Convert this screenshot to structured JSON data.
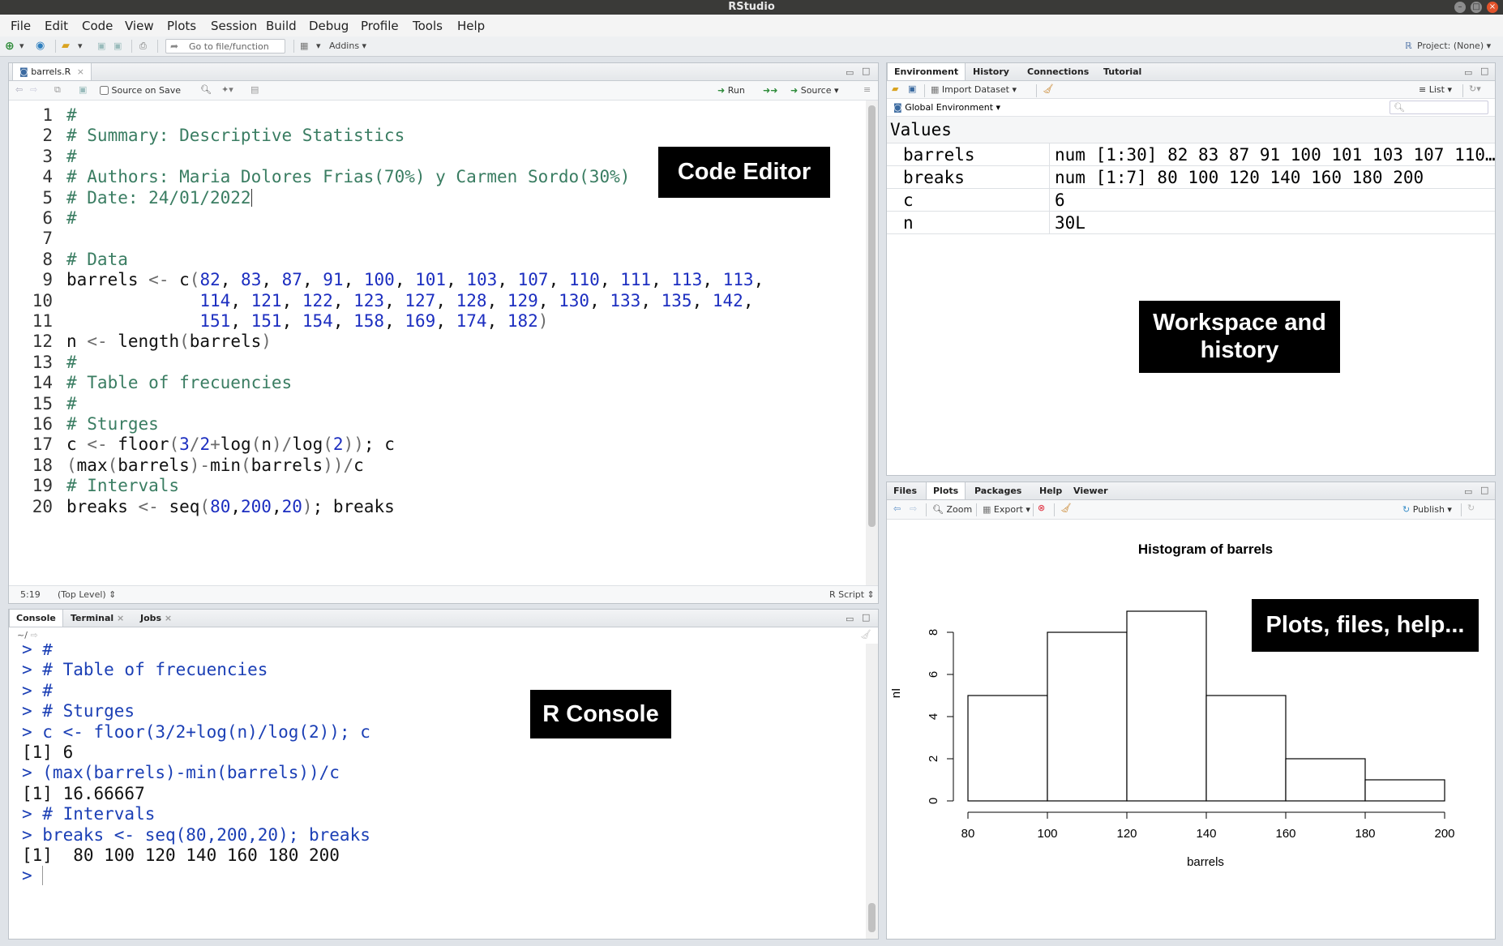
{
  "window": {
    "title": "RStudio"
  },
  "menu": [
    "File",
    "Edit",
    "Code",
    "View",
    "Plots",
    "Session",
    "Build",
    "Debug",
    "Profile",
    "Tools",
    "Help"
  ],
  "toolbar": {
    "goto_placeholder": "Go to file/function",
    "addins": "Addins",
    "project": "Project: (None)"
  },
  "editor": {
    "tab": "barrels.R",
    "source_on_save": "Source on Save",
    "run": "Run",
    "source": "Source",
    "status_pos": "5:19",
    "status_level": "(Top Level)",
    "status_type": "R Script",
    "lines": [
      {
        "n": "1",
        "text": "#"
      },
      {
        "n": "2",
        "text": "# Summary: Descriptive Statistics"
      },
      {
        "n": "3",
        "text": "#"
      },
      {
        "n": "4",
        "text": "# Authors: Maria Dolores Frias(70%) y Carmen Sordo(30%)"
      },
      {
        "n": "5",
        "text": "# Date: 24/01/2022"
      },
      {
        "n": "6",
        "text": "#"
      },
      {
        "n": "7",
        "text": ""
      },
      {
        "n": "8",
        "text": "# Data"
      },
      {
        "n": "9",
        "text": "barrels <- c(82, 83, 87, 91, 100, 101, 103, 107, 110, 111, 113, 113,"
      },
      {
        "n": "10",
        "text": "             114, 121, 122, 123, 127, 128, 129, 130, 133, 135, 142,"
      },
      {
        "n": "11",
        "text": "             151, 151, 154, 158, 169, 174, 182)"
      },
      {
        "n": "12",
        "text": "n <- length(barrels)"
      },
      {
        "n": "13",
        "text": "#"
      },
      {
        "n": "14",
        "text": "# Table of frecuencies"
      },
      {
        "n": "15",
        "text": "#"
      },
      {
        "n": "16",
        "text": "# Sturges"
      },
      {
        "n": "17",
        "text": "c <- floor(3/2+log(n)/log(2)); c"
      },
      {
        "n": "18",
        "text": "(max(barrels)-min(barrels))/c"
      },
      {
        "n": "19",
        "text": "# Intervals"
      },
      {
        "n": "20",
        "text": "breaks <- seq(80,200,20); breaks"
      }
    ]
  },
  "console": {
    "tabs": [
      "Console",
      "Terminal",
      "Jobs"
    ],
    "path": "~/",
    "lines": [
      "> #",
      "> # Table of frecuencies",
      "> #",
      "> # Sturges",
      "> c <- floor(3/2+log(n)/log(2)); c",
      "[1] 6",
      "> (max(barrels)-min(barrels))/c",
      "[1] 16.66667",
      "> # Intervals",
      "> breaks <- seq(80,200,20); breaks",
      "[1]  80 100 120 140 160 180 200",
      ">"
    ]
  },
  "environment": {
    "tabs": [
      "Environment",
      "History",
      "Connections",
      "Tutorial"
    ],
    "import": "Import Dataset",
    "list": "List",
    "global_env": "Global Environment",
    "section": "Values",
    "rows": [
      {
        "name": "barrels",
        "value": "num [1:30] 82 83 87 91 100 101 103 107 110…"
      },
      {
        "name": "breaks",
        "value": "num [1:7] 80 100 120 140 160 180 200"
      },
      {
        "name": "c",
        "value": "6"
      },
      {
        "name": "n",
        "value": "30L"
      }
    ]
  },
  "files": {
    "tabs": [
      "Files",
      "Plots",
      "Packages",
      "Help",
      "Viewer"
    ],
    "zoom": "Zoom",
    "export": "Export",
    "publish": "Publish"
  },
  "labels": {
    "code_editor": "Code Editor",
    "workspace_1": "Workspace and",
    "workspace_2": "history",
    "console": "R Console",
    "plots": "Plots, files, help..."
  },
  "chart_data": {
    "type": "bar",
    "title": "Histogram of barrels",
    "xlabel": "barrels",
    "ylabel": "nI",
    "bin_edges": [
      80,
      100,
      120,
      140,
      160,
      180,
      200
    ],
    "values": [
      5,
      8,
      9,
      5,
      2,
      1
    ],
    "xticks": [
      "80",
      "100",
      "120",
      "140",
      "160",
      "180",
      "200"
    ],
    "yticks": [
      "0",
      "2",
      "4",
      "6",
      "8"
    ],
    "xlim": [
      80,
      200
    ],
    "ylim": [
      0,
      9
    ]
  }
}
